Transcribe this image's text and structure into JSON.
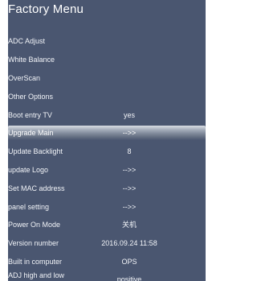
{
  "menu": {
    "title": "Factory Menu",
    "items": [
      {
        "label": "ADC Adjust",
        "value": ""
      },
      {
        "label": "White Balance",
        "value": ""
      },
      {
        "label": "OverScan",
        "value": ""
      },
      {
        "label": "Other Options",
        "value": ""
      },
      {
        "label": "Boot entry TV",
        "value": "yes"
      },
      {
        "label": "Upgrade Main",
        "value": "-->>",
        "selected": true
      },
      {
        "label": "Update Backlight",
        "value": "8"
      },
      {
        "label": "update Logo",
        "value": "-->>"
      },
      {
        "label": "Set MAC address",
        "value": "-->>"
      },
      {
        "label": "panel setting",
        "value": "-->>"
      },
      {
        "label": "Power On Mode",
        "value": "关机"
      },
      {
        "label": "Version number",
        "value": "2016.09.24 11:58"
      },
      {
        "label": "Built in computer",
        "value": "OPS"
      },
      {
        "label": "ADJ high and low",
        "value": "positive"
      }
    ]
  },
  "colors": {
    "panel_background": "#4a5670",
    "text": "#f2f4f8",
    "selection_highlight": "#9aa3b2"
  }
}
